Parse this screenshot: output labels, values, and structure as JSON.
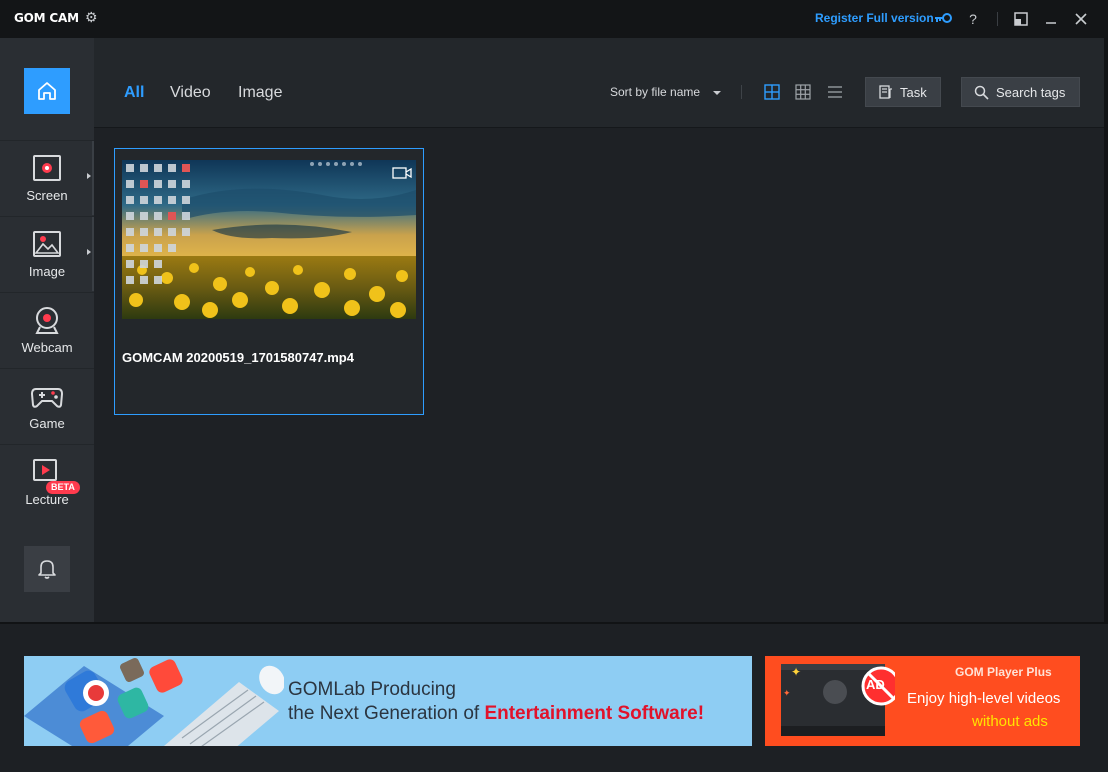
{
  "titlebar": {
    "logo": "GOM CAM",
    "register_label": "Register Full version",
    "help": "?",
    "close": "✕",
    "minimize": "—"
  },
  "sidebar": {
    "items": [
      {
        "label": "Screen"
      },
      {
        "label": "Image"
      },
      {
        "label": "Webcam"
      },
      {
        "label": "Game"
      },
      {
        "label": "Lecture",
        "badge": "BETA"
      }
    ]
  },
  "filters": [
    "All",
    "Video",
    "Image"
  ],
  "sort": {
    "label": "Sort by file name"
  },
  "buttons": {
    "task": "Task",
    "search_tags": "Search tags"
  },
  "files": [
    {
      "name": "GOMCAM 20200519_1701580747.mp4",
      "type": "video"
    }
  ],
  "ads": {
    "left": {
      "line1": "GOMLab Producing",
      "line2_prefix": "the Next Generation of ",
      "line2_highlight": "Entertainment Software!"
    },
    "right": {
      "brand": "GOM Player Plus",
      "line1": "Enjoy high-level videos",
      "line2": "without ads",
      "badge": "AD"
    }
  },
  "colors": {
    "accent": "#2e9dff",
    "beta": "#ff3b4e",
    "ad_right_bg": "#ff4d1f",
    "ad_left_bg": "#8ecdf3"
  }
}
